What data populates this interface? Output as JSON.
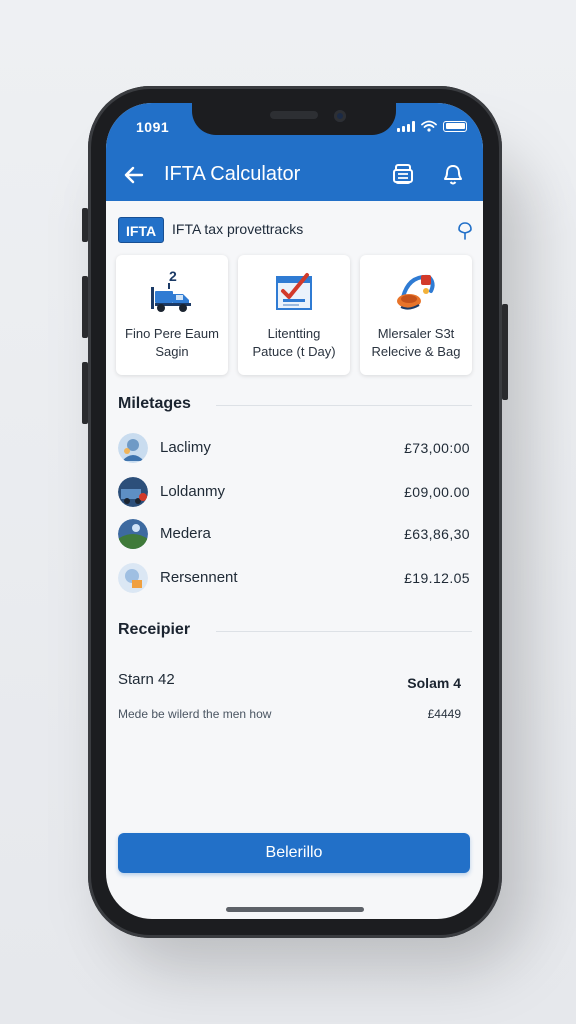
{
  "status_bar": {
    "time": "1091"
  },
  "header": {
    "title": "IFTA Calculator"
  },
  "info": {
    "badge": "IFTA",
    "text": "IFTA tax provettracks"
  },
  "cards": [
    {
      "label_line1": "Fino Pere Eaum",
      "label_line2": "Sagin",
      "icon": "truck-icon"
    },
    {
      "label_line1": "Litentting",
      "label_line2": "Patuce (t Day)",
      "icon": "checklist-icon"
    },
    {
      "label_line1": "Mlersaler S3t",
      "label_line2": "Relecive & Bag",
      "icon": "fuel-pump-icon"
    }
  ],
  "mileages": {
    "title": "Miletages",
    "items": [
      {
        "name": "Laclimy",
        "amount": "£73,00:00"
      },
      {
        "name": "Loldanmy",
        "amount": "£09,00.00"
      },
      {
        "name": "Medera",
        "amount": "£63,86,30"
      },
      {
        "name": "Rersennent",
        "amount": "£19.12.05"
      }
    ]
  },
  "receipts": {
    "title": "Receipier",
    "summary_label": "Starn 42",
    "summary_value": "Solam 4",
    "note": "Mede be wilerd the men how",
    "note_value": "£4449"
  },
  "action": {
    "button_label": "Belerillo"
  },
  "colors": {
    "primary": "#2270c8",
    "background": "#f6f7f9"
  }
}
